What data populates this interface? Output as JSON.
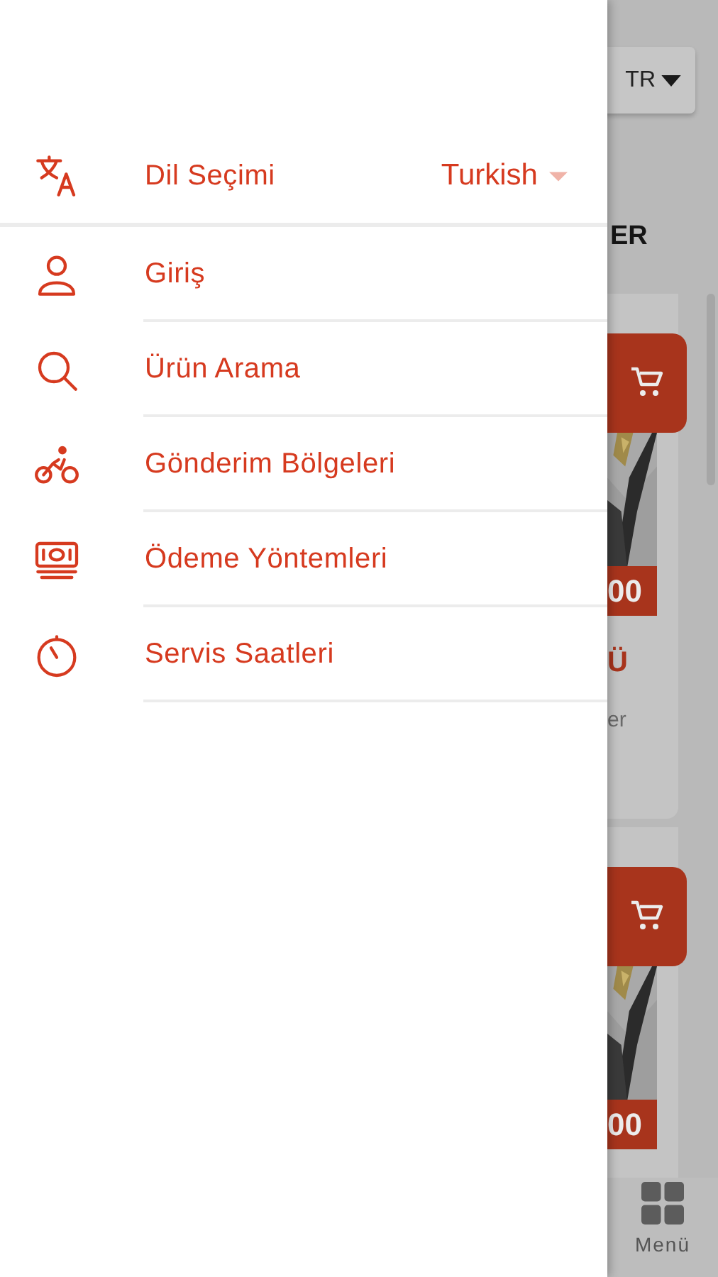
{
  "drawer": {
    "language": {
      "label": "Dil Seçimi",
      "value": "Turkish"
    },
    "items": [
      {
        "label": "Giriş"
      },
      {
        "label": "Ürün Arama"
      },
      {
        "label": "Gönderim Bölgeleri"
      },
      {
        "label": "Ödeme Yöntemleri"
      },
      {
        "label": "Servis Saatleri"
      }
    ]
  },
  "background": {
    "language_button": "TR",
    "header_text": "ER",
    "cards": [
      {
        "price": "00",
        "title": "Ü",
        "text": "er"
      },
      {
        "price": "00"
      }
    ],
    "bottom_nav": {
      "label": "Menü"
    }
  }
}
